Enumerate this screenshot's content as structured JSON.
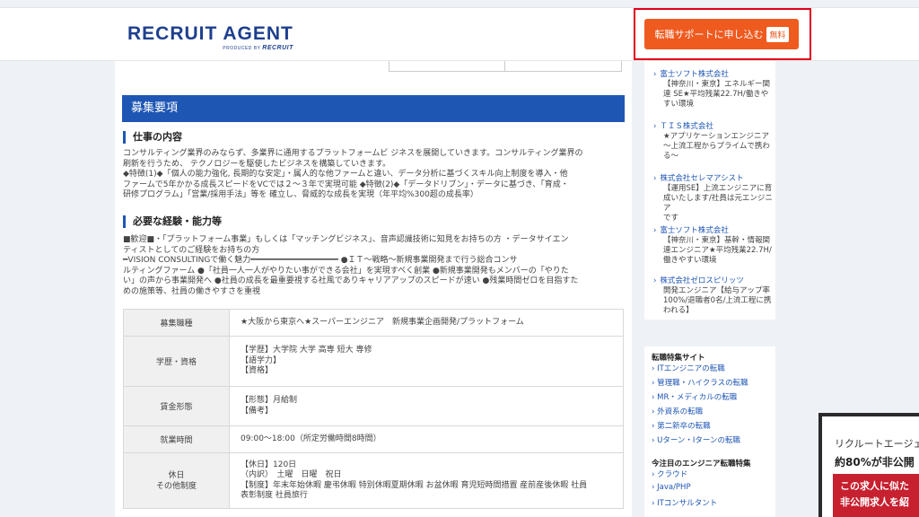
{
  "header": {
    "logo_main": "RECRUIT AGENT",
    "logo_sub": "PRODUCED BY",
    "logo_sub_brand": "RECRUIT",
    "cta_label": "転職サポートに申し込む",
    "cta_badge": "無料"
  },
  "main": {
    "section_title": "募集要項",
    "job_content_heading": "仕事の内容",
    "job_content_text": "コンサルティング業界のみならず、多業界に通用するプラットフォームビ ジネスを展開していきます。コンサルティング業界の\n刷新を行うため、 テクノロジーを駆使したビジネスを構築していきます。\n◆特徴(1)◆「個人の能力強化, 長期的な安定」・属人的な他ファームと違い、データ分析に基づくスキル向上制度を導入・他\nファームで5年かかる成長スピードをVCでは２～３年で実現可能 ◆特徴(2)◆「データドリブン」・データに基づき、「育成・\n研修プログラム」「営業/採用手法」等を 確立し、脅威的な成長を実現（年平均%300超の成長率）",
    "skills_heading": "必要な経験・能力等",
    "skills_text": "■歓迎■・「プラットフォーム事業」もしくは「マッチングビジネス」、音声認識技術に知見をお持ちの方 ・データサイエン\nティストとしてのご経験をお持ちの方\n━VISION CONSULTINGで働く魅力━━━━━━━━━━━━━━━━━━ ●ＩＴ～戦略～新規事業開発まで行う総合コンサ\nルティングファーム ●「社員一人一人がやりたい事ができる会社」を実現すべく創業 ●新規事業開発もメンバーの「やりた\nい」の声から事業開発へ ●社員の成長を最重要視する社風でありキャリアアップのスピードが速い ●残業時間ゼロを目指すた\nめの施策等、社員の働きやすさを重視",
    "table": [
      {
        "label": "募集職種",
        "value": "★大阪から東京へ★スーパーエンジニア　新規事業企画開発/プラットフォーム"
      },
      {
        "label": "学歴・資格",
        "value": "【学歴】大学院 大学 高専 短大 専修\n【語学力】\n【資格】"
      },
      {
        "label": "賃金形態",
        "value": "【形態】月給制\n【備考】"
      },
      {
        "label": "就業時間",
        "value": "09:00～18:00（所定労働時間8時間）"
      },
      {
        "label": "休日\nその他制度",
        "value": "【休日】120日\n（内訳）　土曜　日曜　祝日\n【制度】年末年始休暇 慶弔休暇 特別休暇夏期休暇 お盆休暇 育児短時間措置 産前産後休暇 社員\n表彰制度 社員旅行"
      }
    ]
  },
  "side_jobs": [
    {
      "company": "富士ソフト株式会社",
      "desc": "【神奈川・東京】エネルギー関\n連 SE★平均残業22.7H/働きや\nすい環境"
    },
    {
      "company": "ＴＩＳ株式会社",
      "desc": "★アプリケーションエンジニア\n～上流工程からプライムで携わ\nる～"
    },
    {
      "company": "株式会社セレマアシスト",
      "desc": "【運用SE】上流エンジニアに育\n成いたします/社員は元エンジニア\nです"
    },
    {
      "company": "富士ソフト株式会社",
      "desc": "【神奈川・東京】基幹・情報関\n連エンジニア★平均残業22.7H/\n働きやすい環境"
    },
    {
      "company": "株式会社ゼロスピリッツ",
      "desc": "開発エンジニア【給与アップ率\n100%/退職者0名/上流工程に携\nわれる】"
    }
  ],
  "features": {
    "title": "転職特集サイト",
    "links": [
      "ITエンジニアの転職",
      "管理職・ハイクラスの転職",
      "MR・メディカルの転職",
      "外資系の転職",
      "第二新卒の転職",
      "Uターン・Iターンの転職"
    ],
    "title2": "今注目のエンジニア転職特集",
    "links2": [
      "クラウド",
      "Java/PHP",
      "ITコンサルタント"
    ]
  },
  "ad": {
    "line1": "リクルートエージェ",
    "line2": "約80%が非公開",
    "red_line1": "この求人に似た",
    "red_line2": "非公開求人を紹"
  }
}
